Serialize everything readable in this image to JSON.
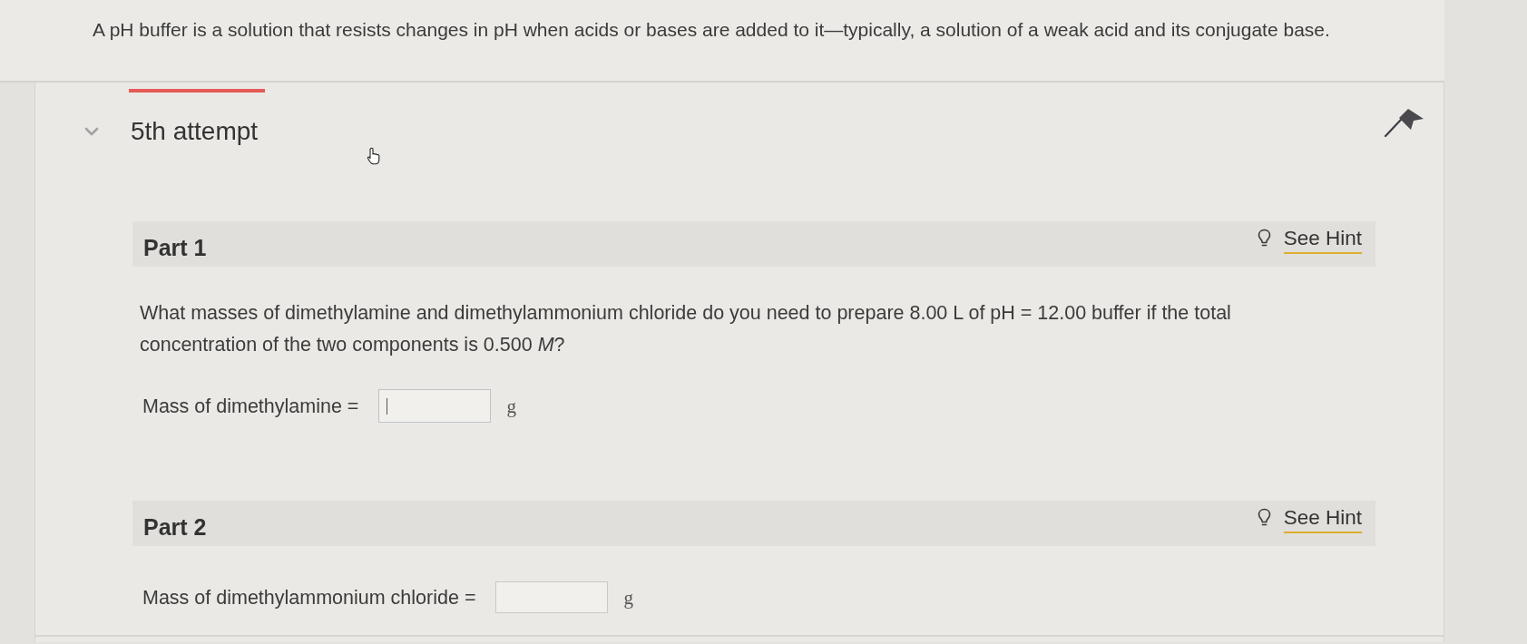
{
  "intro": {
    "text": "A pH buffer is a solution that resists changes in pH when acids or bases are added to it—typically, a solution of a weak acid and its conjugate base."
  },
  "attempt": {
    "label": "5th attempt",
    "expanded": true
  },
  "parts": [
    {
      "title": "Part 1",
      "hint": "See Hint",
      "question": "What masses of dimethylamine and dimethylammonium chloride do you need to prepare 8.00 L of pH = 12.00 buffer if the total concentration of the two components is 0.500 *M*?",
      "answers": [
        {
          "label": "Mass of dimethylamine =",
          "unit": "g",
          "focused": true
        }
      ]
    },
    {
      "title": "Part 2",
      "hint": "See Hint",
      "answers": [
        {
          "label": "Mass of dimethylammonium chloride =",
          "unit": "g",
          "focused": false
        }
      ]
    }
  ]
}
